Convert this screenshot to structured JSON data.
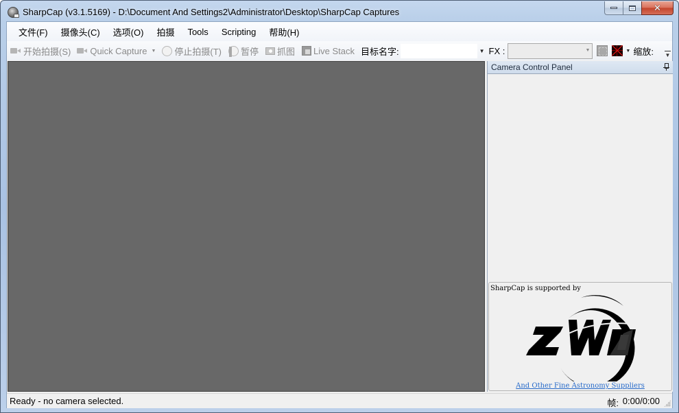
{
  "window": {
    "title": "SharpCap (v3.1.5169) - D:\\Document And Settings2\\Administrator\\Desktop\\SharpCap Captures",
    "caption_buttons": [
      "minimize",
      "maximize",
      "close"
    ]
  },
  "menubar": {
    "items": [
      {
        "label": "文件(F)"
      },
      {
        "label": "摄像头(C)"
      },
      {
        "label": "选项(O)"
      },
      {
        "label": "拍摄"
      },
      {
        "label": "Tools"
      },
      {
        "label": "Scripting"
      },
      {
        "label": "帮助(H)"
      }
    ]
  },
  "toolbar": {
    "start_capture": {
      "label": "开始拍摄(S)",
      "icon": "video-camera-icon",
      "enabled": false
    },
    "quick_capture": {
      "label": "Quick Capture",
      "icon": "video-camera-icon",
      "enabled": false
    },
    "stop_capture": {
      "label": "停止拍摄(T)",
      "icon": "stop-icon",
      "enabled": false
    },
    "pause": {
      "label": "暂停",
      "icon": "pause-icon",
      "enabled": false
    },
    "snapshot": {
      "label": "抓图",
      "icon": "camera-icon",
      "enabled": false
    },
    "live_stack": {
      "label": "Live Stack",
      "icon": "stack-icon",
      "enabled": false
    },
    "target_name_label": "目标名字:",
    "target_name_value": "",
    "fx_label": "FX :",
    "fx_value": "",
    "zoom_label": "缩放:",
    "zoom_value": ""
  },
  "side_panel": {
    "title": "Camera Control Panel",
    "sponsor_text": "SharpCap is supported by",
    "sponsor_logo": "ZWO",
    "sponsor_link": "And Other Fine Astronomy Suppliers"
  },
  "statusbar": {
    "status": "Ready - no camera selected.",
    "frames_label": "帧:",
    "frames_value": "0:00/0:00"
  },
  "colors": {
    "viewport_bg": "#686868",
    "link": "#2569c9",
    "reticle": "#ff1a1a"
  }
}
